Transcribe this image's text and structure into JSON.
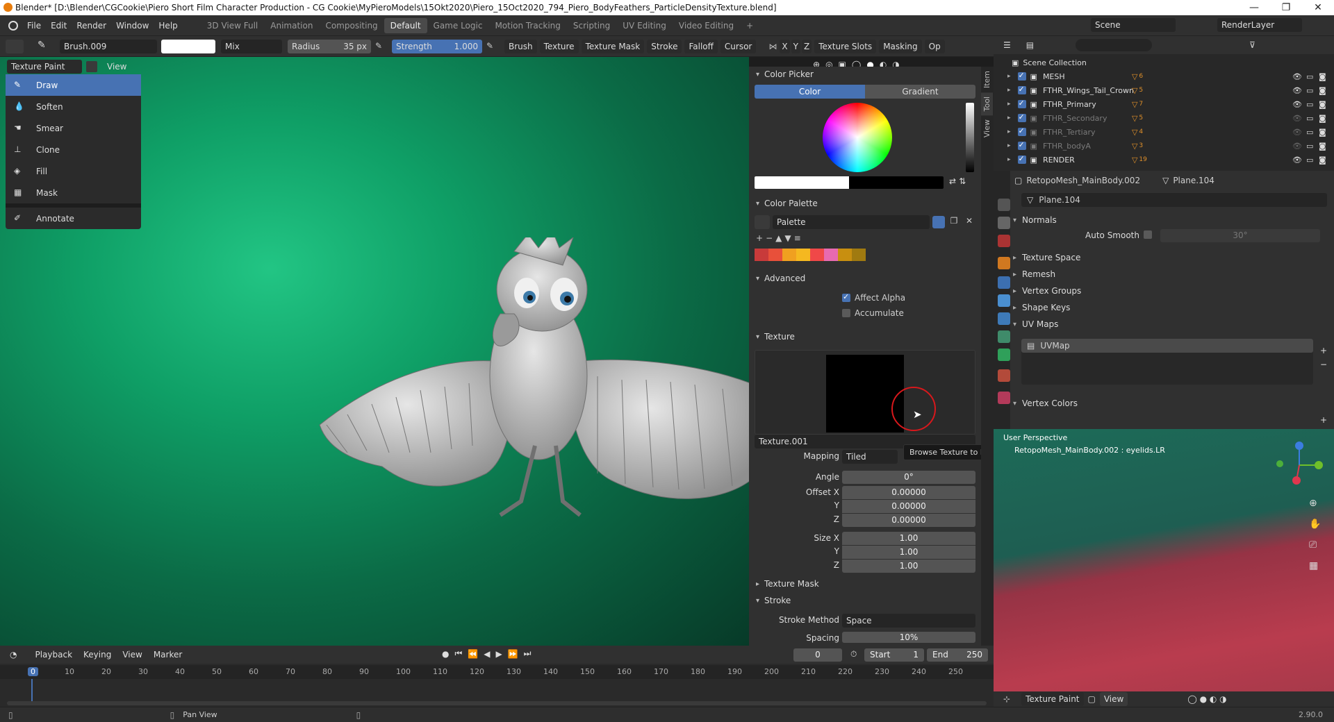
{
  "titlebar": {
    "title": "Blender* [D:\\Blender\\CGCookie\\Piero Short Film Character Production - CG Cookie\\MyPieroModels\\15Okt2020\\Piero_15Oct2020_794_Piero_BodyFeathers_ParticleDensityTexture.blend]",
    "minimize": "—",
    "maximize": "❐",
    "close": "✕"
  },
  "menu": {
    "items": [
      "File",
      "Edit",
      "Render",
      "Window",
      "Help"
    ],
    "workspaces": [
      "3D View Full",
      "Animation",
      "Compositing",
      "Default",
      "Game Logic",
      "Motion Tracking",
      "Scripting",
      "UV Editing",
      "Video Editing"
    ],
    "active_workspace": "Default",
    "add": "+"
  },
  "scene": {
    "name": "Scene",
    "view_layer": "RenderLayer"
  },
  "toolheader": {
    "brush": "Brush.009",
    "blend": "Mix",
    "radius_label": "Radius",
    "radius_value": "35 px",
    "strength_label": "Strength",
    "strength_value": "1.000",
    "brush_menu": "Brush",
    "texture_menu": "Texture",
    "texture_mask_menu": "Texture Mask",
    "stroke_menu": "Stroke",
    "falloff_menu": "Falloff",
    "cursor_menu": "Cursor",
    "x": "X",
    "y": "Y",
    "z": "Z",
    "texture_slots": "Texture Slots",
    "masking": "Masking",
    "options": "Op"
  },
  "viewport_header": {
    "mode": "Texture Paint",
    "view": "View"
  },
  "tools": [
    {
      "label": "Draw",
      "icon": "draw-icon"
    },
    {
      "label": "Soften",
      "icon": "soften-icon"
    },
    {
      "label": "Smear",
      "icon": "smear-icon"
    },
    {
      "label": "Clone",
      "icon": "clone-icon"
    },
    {
      "label": "Fill",
      "icon": "fill-icon"
    },
    {
      "label": "Mask",
      "icon": "mask-icon"
    },
    {
      "label": "Annotate",
      "icon": "annotate-icon"
    }
  ],
  "npanel": {
    "tabs": [
      "Item",
      "Tool",
      "View"
    ],
    "color_picker": "Color Picker",
    "color_tab": "Color",
    "gradient_tab": "Gradient",
    "color_palette": "Color Palette",
    "palette_name": "Palette",
    "palette_swatches": [
      "#c83a3a",
      "#e8503a",
      "#f0a020",
      "#f5b820",
      "#f04848",
      "#e86ab0",
      "#c88f10",
      "#a07a10"
    ],
    "advanced": "Advanced",
    "affect_alpha": "Affect Alpha",
    "accumulate": "Accumulate",
    "texture": "Texture",
    "texture_name": "Texture.001",
    "tooltip": "Browse Texture to be linked.",
    "mapping_label": "Mapping",
    "mapping_value": "Tiled",
    "angle_label": "Angle",
    "angle_value": "0°",
    "offset_x_label": "Offset X",
    "offset_x": "0.00000",
    "offset_y_label": "Y",
    "offset_y": "0.00000",
    "offset_z_label": "Z",
    "offset_z": "0.00000",
    "size_x_label": "Size X",
    "size_x": "1.00",
    "size_y_label": "Y",
    "size_y": "1.00",
    "size_z_label": "Z",
    "size_z": "1.00",
    "texture_mask": "Texture Mask",
    "stroke": "Stroke",
    "stroke_method_label": "Stroke Method",
    "stroke_method": "Space",
    "spacing_label": "Spacing",
    "spacing": "10%"
  },
  "outliner": {
    "root": "Scene Collection",
    "items": [
      {
        "name": "MESH",
        "dim": false,
        "badge": "6"
      },
      {
        "name": "FTHR_Wings_Tail_Crown",
        "dim": false,
        "badge": "5"
      },
      {
        "name": "FTHR_Primary",
        "dim": false,
        "badge": "7"
      },
      {
        "name": "FTHR_Secondary",
        "dim": true,
        "badge": "5"
      },
      {
        "name": "FTHR_Tertiary",
        "dim": true,
        "badge": "4"
      },
      {
        "name": "FTHR_bodyA",
        "dim": true,
        "badge": "3"
      },
      {
        "name": "RENDER",
        "dim": false,
        "badge": "19"
      }
    ]
  },
  "properties": {
    "object": "RetopoMesh_MainBody.002",
    "mesh": "Plane.104",
    "data_name": "Plane.104",
    "normals": "Normals",
    "auto_smooth": "Auto Smooth",
    "auto_smooth_angle": "30°",
    "panels": [
      "Texture Space",
      "Remesh",
      "Vertex Groups",
      "Shape Keys"
    ],
    "uv_maps": "UV Maps",
    "uvmap": "UVMap",
    "vertex_colors": "Vertex Colors"
  },
  "mini3d": {
    "perspective": "User Perspective",
    "object_info": "RetopoMesh_MainBody.002 : eyelids.LR",
    "mode": "Texture Paint",
    "view": "View"
  },
  "timeline": {
    "menus": [
      "Playback",
      "Keying",
      "View",
      "Marker"
    ],
    "current": "0",
    "start_label": "Start",
    "start": "1",
    "end_label": "End",
    "end": "250",
    "ticks": [
      "0",
      "10",
      "20",
      "30",
      "40",
      "50",
      "60",
      "70",
      "80",
      "90",
      "100",
      "110",
      "120",
      "130",
      "140",
      "150",
      "160",
      "170",
      "180",
      "190",
      "200",
      "210",
      "220",
      "230",
      "240",
      "250"
    ]
  },
  "status": {
    "hint": "Pan View",
    "version": "2.90.0"
  }
}
